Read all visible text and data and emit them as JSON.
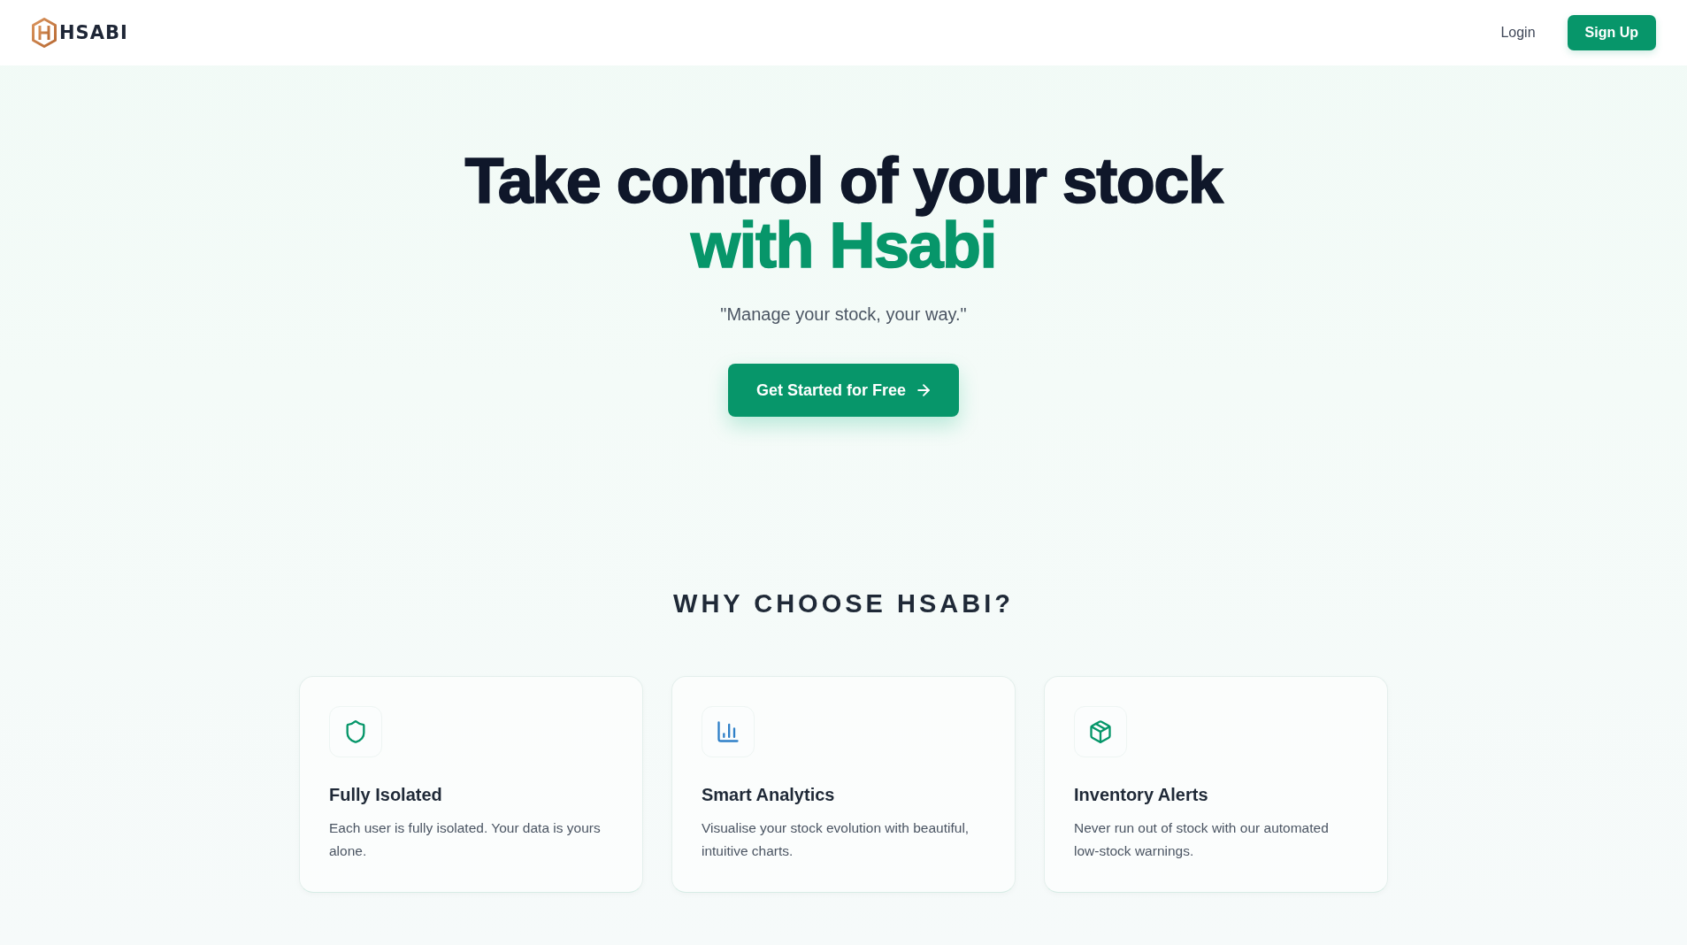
{
  "header": {
    "logo": {
      "text": "HSABI"
    },
    "nav": [
      {
        "label": "Login",
        "kind": "link"
      },
      {
        "label": "Sign Up",
        "kind": "primary"
      }
    ]
  },
  "hero": {
    "title_line_1": "Take control of your stock",
    "title_line_2": "with Hsabi",
    "tagline": "\"Manage your stock, your way.\"",
    "cta": {
      "label": "Get Started for Free"
    }
  },
  "features": {
    "heading": "WHY CHOOSE HSABI?",
    "cards": [
      {
        "title": "Fully Isolated",
        "description": "Each user is fully isolated. Your data is yours alone.",
        "color": "#059669"
      },
      {
        "title": "Smart Analytics",
        "description": "Visualise your stock evolution with beautiful, intuitive charts.",
        "color": "#2f80c8"
      },
      {
        "title": "Inventory Alerts",
        "description": "Never run out of stock with our automated low-stock warnings.",
        "color": "#059669"
      }
    ]
  }
}
